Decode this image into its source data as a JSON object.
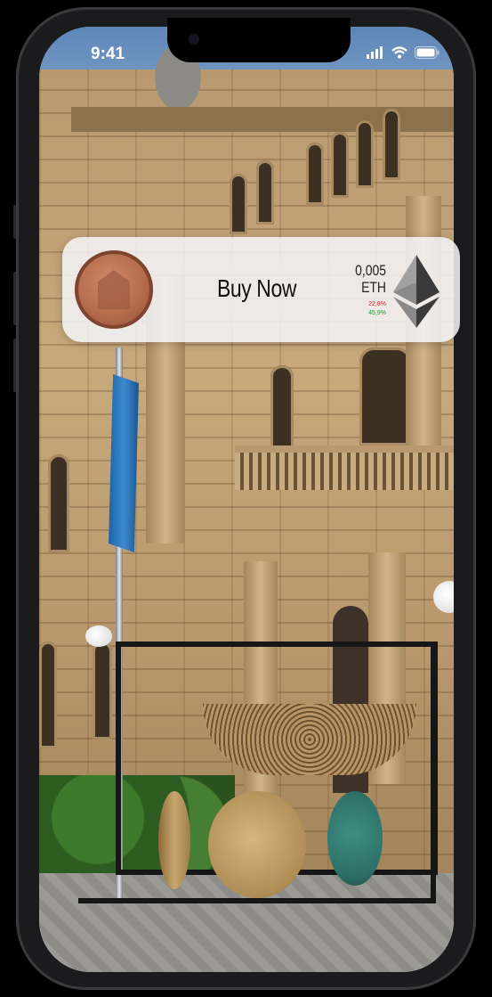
{
  "status_bar": {
    "time": "9:41",
    "icons": [
      "signal-icon",
      "wifi-icon",
      "battery-icon"
    ]
  },
  "nft_card": {
    "coin_icon": "copper-coin-icon",
    "buy_label": "Buy Now",
    "price_value": "0,005",
    "price_currency": "ETH",
    "change_down": "22,8%",
    "change_up": "45,9%",
    "currency_icon": "ethereum-icon",
    "colors": {
      "change_down": "#d22222",
      "change_up": "#1a9a2a"
    }
  }
}
